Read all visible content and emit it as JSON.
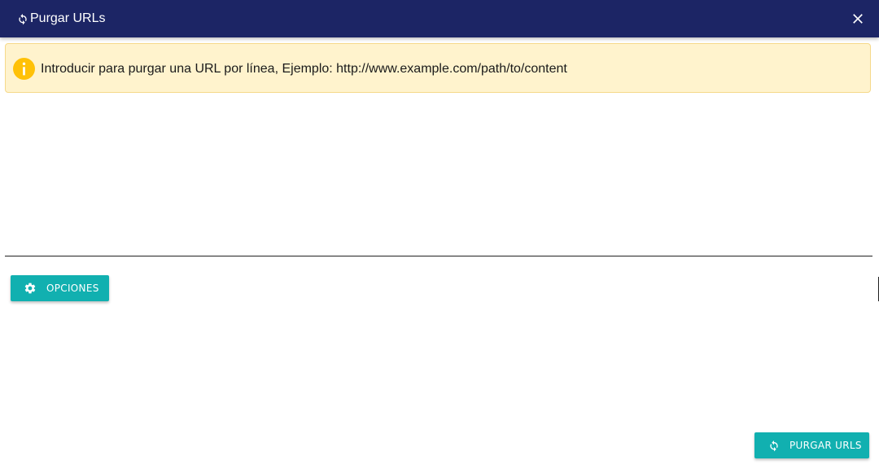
{
  "dialog": {
    "title": "Purgar URLs",
    "title_icon": "refresh-icon",
    "close_icon": "close-icon"
  },
  "alert": {
    "icon": "info-icon",
    "message": "Introducir para purgar una URL por línea, Ejemplo: http://www.example.com/path/to/content"
  },
  "urls_input": {
    "value": "",
    "placeholder": ""
  },
  "options_button": {
    "icon": "gear-icon",
    "label": "OPCIONES"
  },
  "purge_button": {
    "icon": "refresh-icon",
    "label": "PURGAR URLS"
  },
  "colors": {
    "titlebar": "#1c2565",
    "accent_button": "#11b0b0",
    "alert_background": "#fff3cd",
    "alert_icon": "#ffc107"
  }
}
